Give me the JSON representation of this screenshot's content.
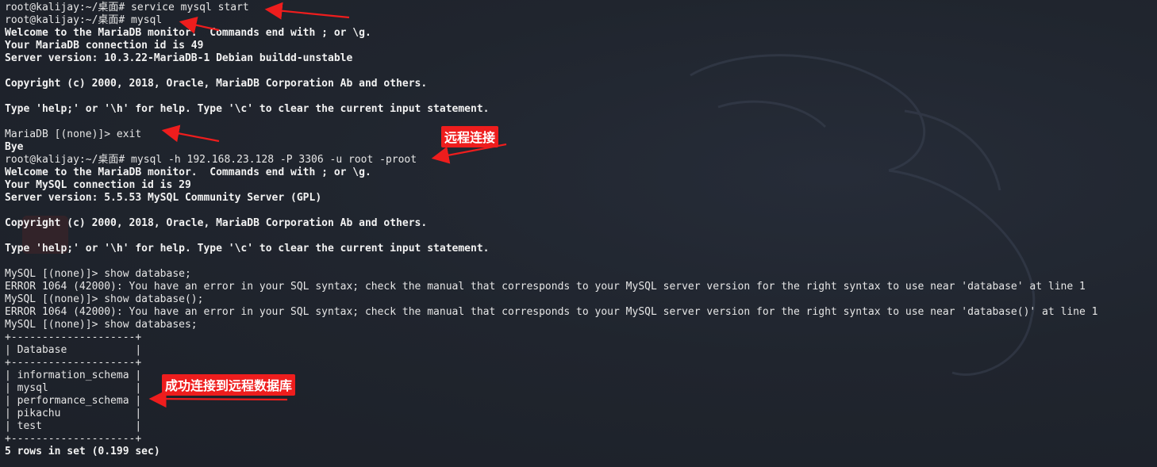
{
  "terminal": {
    "lines": [
      {
        "text": "root@kalijay:~/桌面# service mysql start",
        "bold": false
      },
      {
        "text": "root@kalijay:~/桌面# mysql",
        "bold": false
      },
      {
        "text": "Welcome to the MariaDB monitor.  Commands end with ; or \\g.",
        "bold": true
      },
      {
        "text": "Your MariaDB connection id is 49",
        "bold": true
      },
      {
        "text": "Server version: 10.3.22-MariaDB-1 Debian buildd-unstable",
        "bold": true
      },
      {
        "text": "",
        "bold": false
      },
      {
        "text": "Copyright (c) 2000, 2018, Oracle, MariaDB Corporation Ab and others.",
        "bold": true
      },
      {
        "text": "",
        "bold": false
      },
      {
        "text": "Type 'help;' or '\\h' for help. Type '\\c' to clear the current input statement.",
        "bold": true
      },
      {
        "text": "",
        "bold": false
      },
      {
        "text": "MariaDB [(none)]> exit",
        "bold": false
      },
      {
        "text": "Bye",
        "bold": true
      },
      {
        "text": "root@kalijay:~/桌面# mysql -h 192.168.23.128 -P 3306 -u root -proot",
        "bold": false
      },
      {
        "text": "Welcome to the MariaDB monitor.  Commands end with ; or \\g.",
        "bold": true
      },
      {
        "text": "Your MySQL connection id is 29",
        "bold": true
      },
      {
        "text": "Server version: 5.5.53 MySQL Community Server (GPL)",
        "bold": true
      },
      {
        "text": "",
        "bold": false
      },
      {
        "text": "Copyright (c) 2000, 2018, Oracle, MariaDB Corporation Ab and others.",
        "bold": true
      },
      {
        "text": "",
        "bold": false
      },
      {
        "text": "Type 'help;' or '\\h' for help. Type '\\c' to clear the current input statement.",
        "bold": true
      },
      {
        "text": "",
        "bold": false
      },
      {
        "text": "MySQL [(none)]> show database;",
        "bold": false
      },
      {
        "text": "ERROR 1064 (42000): You have an error in your SQL syntax; check the manual that corresponds to your MySQL server version for the right syntax to use near 'database' at line 1",
        "bold": false
      },
      {
        "text": "MySQL [(none)]> show database();",
        "bold": false
      },
      {
        "text": "ERROR 1064 (42000): You have an error in your SQL syntax; check the manual that corresponds to your MySQL server version for the right syntax to use near 'database()' at line 1",
        "bold": false
      },
      {
        "text": "MySQL [(none)]> show databases;",
        "bold": false
      },
      {
        "text": "+--------------------+",
        "bold": false
      },
      {
        "text": "| Database           |",
        "bold": false
      },
      {
        "text": "+--------------------+",
        "bold": false
      },
      {
        "text": "| information_schema |",
        "bold": false
      },
      {
        "text": "| mysql              |",
        "bold": false
      },
      {
        "text": "| performance_schema |",
        "bold": false
      },
      {
        "text": "| pikachu            |",
        "bold": false
      },
      {
        "text": "| test               |",
        "bold": false
      },
      {
        "text": "+--------------------+",
        "bold": false
      },
      {
        "text": "5 rows in set (0.199 sec)",
        "bold": true
      }
    ]
  },
  "annotations": {
    "remote_connect": "远程连接",
    "success": "成功连接到远程数据库"
  },
  "colors": {
    "background": "#1e222a",
    "text": "#e6e6e6",
    "annotation_red": "#ee1d1d"
  }
}
